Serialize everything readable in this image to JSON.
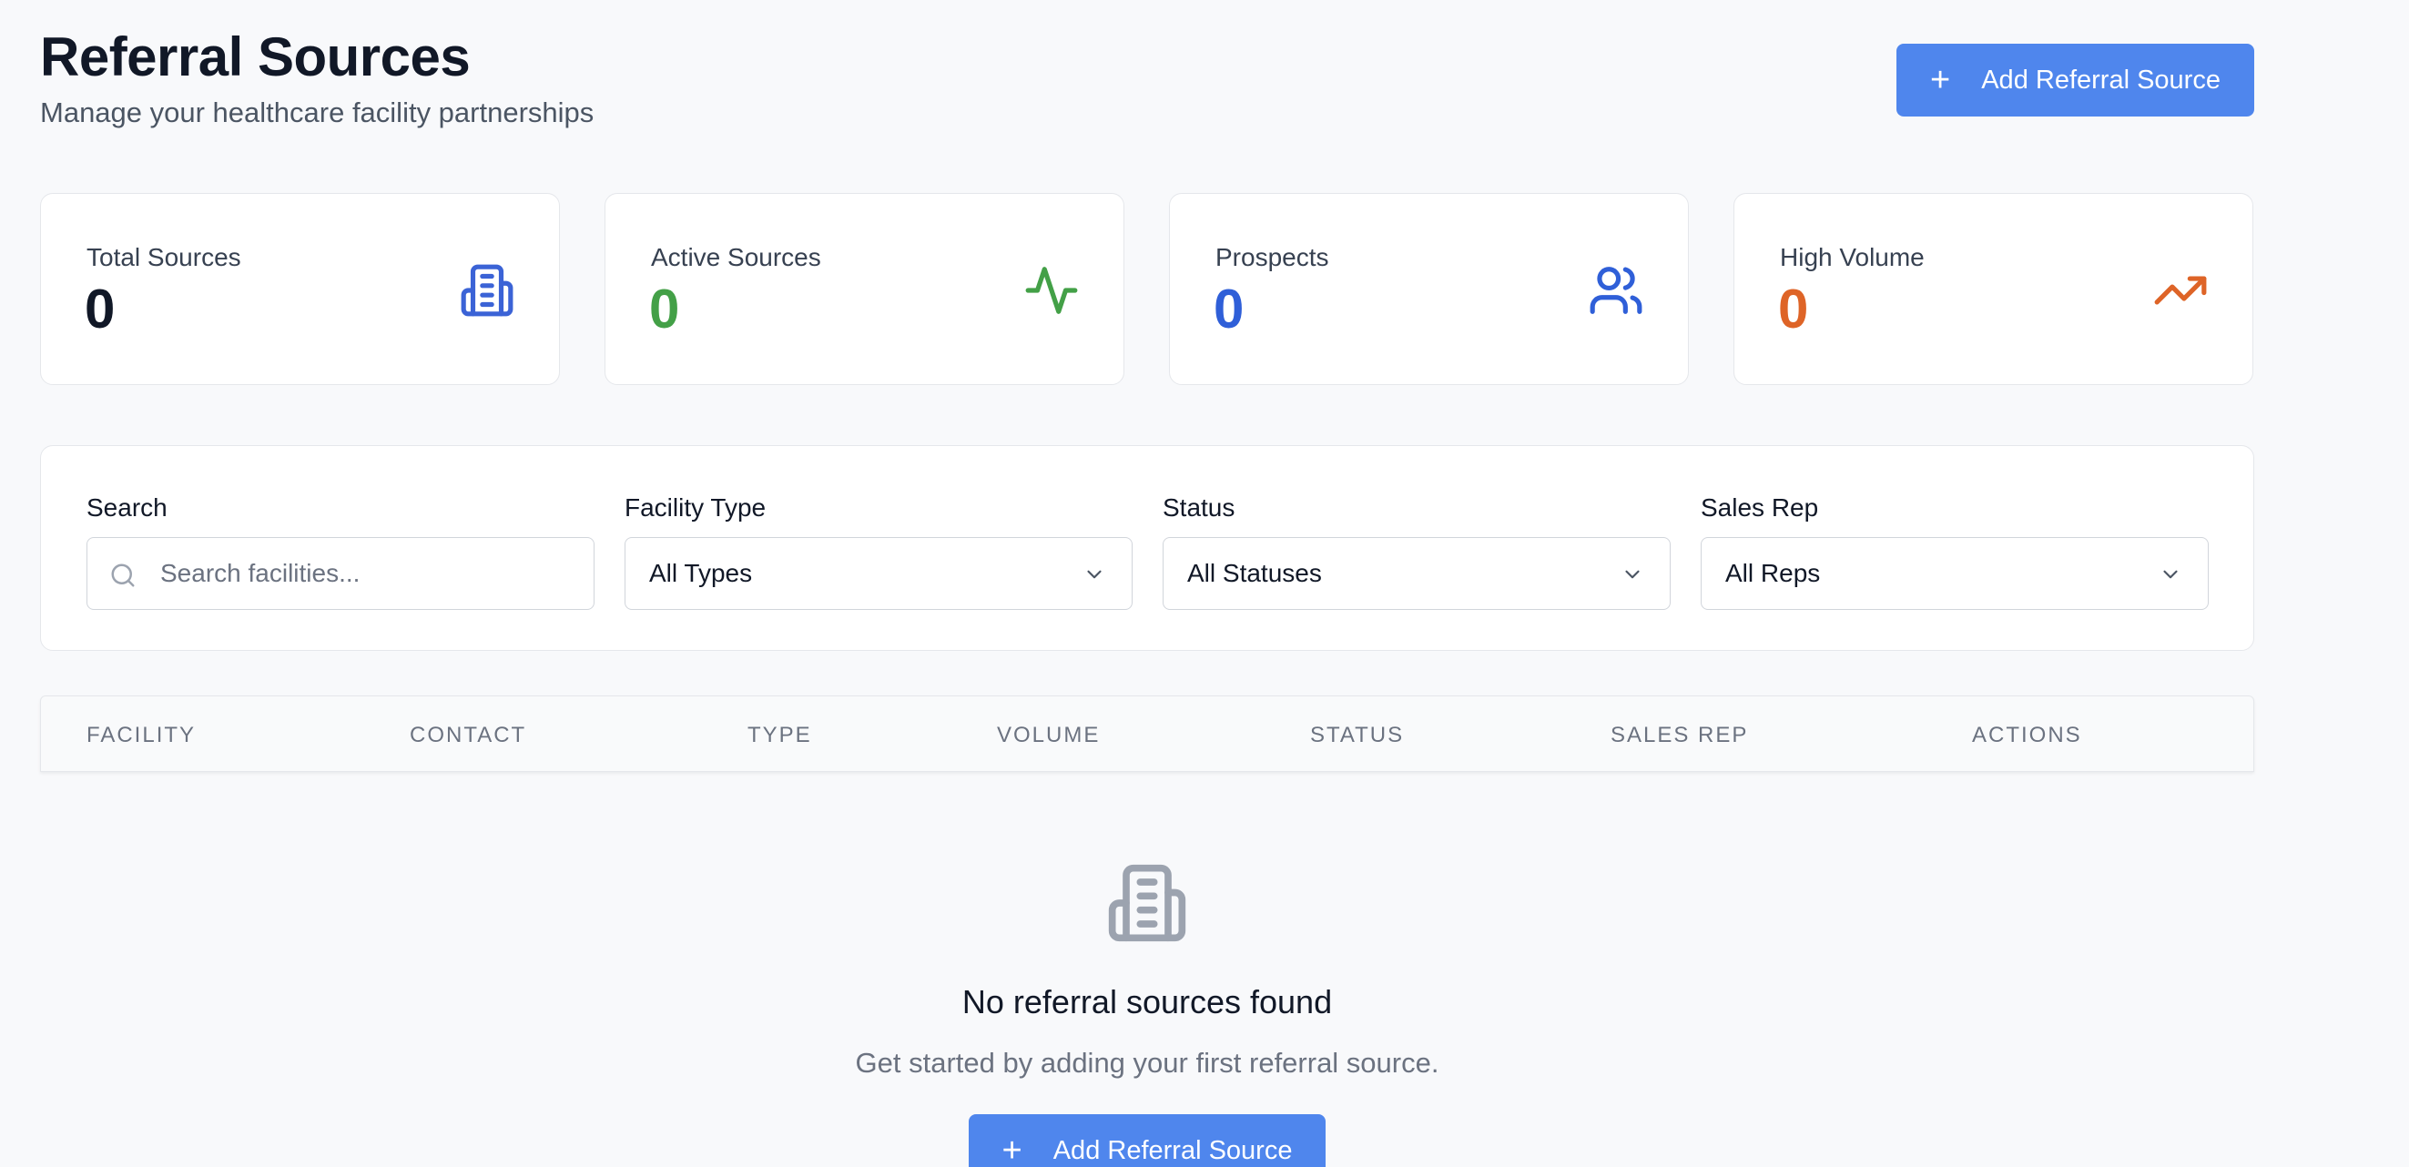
{
  "header": {
    "title": "Referral Sources",
    "subtitle": "Manage your healthcare facility partnerships",
    "add_button_label": "Add Referral Source"
  },
  "stats": [
    {
      "label": "Total Sources",
      "value": "0",
      "color": "#111827",
      "icon": "building-icon",
      "icon_color": "#3b63d6"
    },
    {
      "label": "Active Sources",
      "value": "0",
      "color": "#43a047",
      "icon": "activity-icon",
      "icon_color": "#43a047"
    },
    {
      "label": "Prospects",
      "value": "0",
      "color": "#2f5fd8",
      "icon": "users-icon",
      "icon_color": "#2f5fd8"
    },
    {
      "label": "High Volume",
      "value": "0",
      "color": "#de6427",
      "icon": "trending-up-icon",
      "icon_color": "#de6427"
    }
  ],
  "filters": {
    "search": {
      "label": "Search",
      "placeholder": "Search facilities..."
    },
    "facility_type": {
      "label": "Facility Type",
      "value": "All Types"
    },
    "status": {
      "label": "Status",
      "value": "All Statuses"
    },
    "sales_rep": {
      "label": "Sales Rep",
      "value": "All Reps"
    }
  },
  "table": {
    "columns": [
      "Facility",
      "Contact",
      "Type",
      "Volume",
      "Status",
      "Sales Rep",
      "Actions"
    ]
  },
  "empty_state": {
    "title": "No referral sources found",
    "text": "Get started by adding your first referral source.",
    "button_label": "Add Referral Source"
  },
  "colors": {
    "primary": "#4f86ed",
    "background": "#f8f9fb"
  }
}
